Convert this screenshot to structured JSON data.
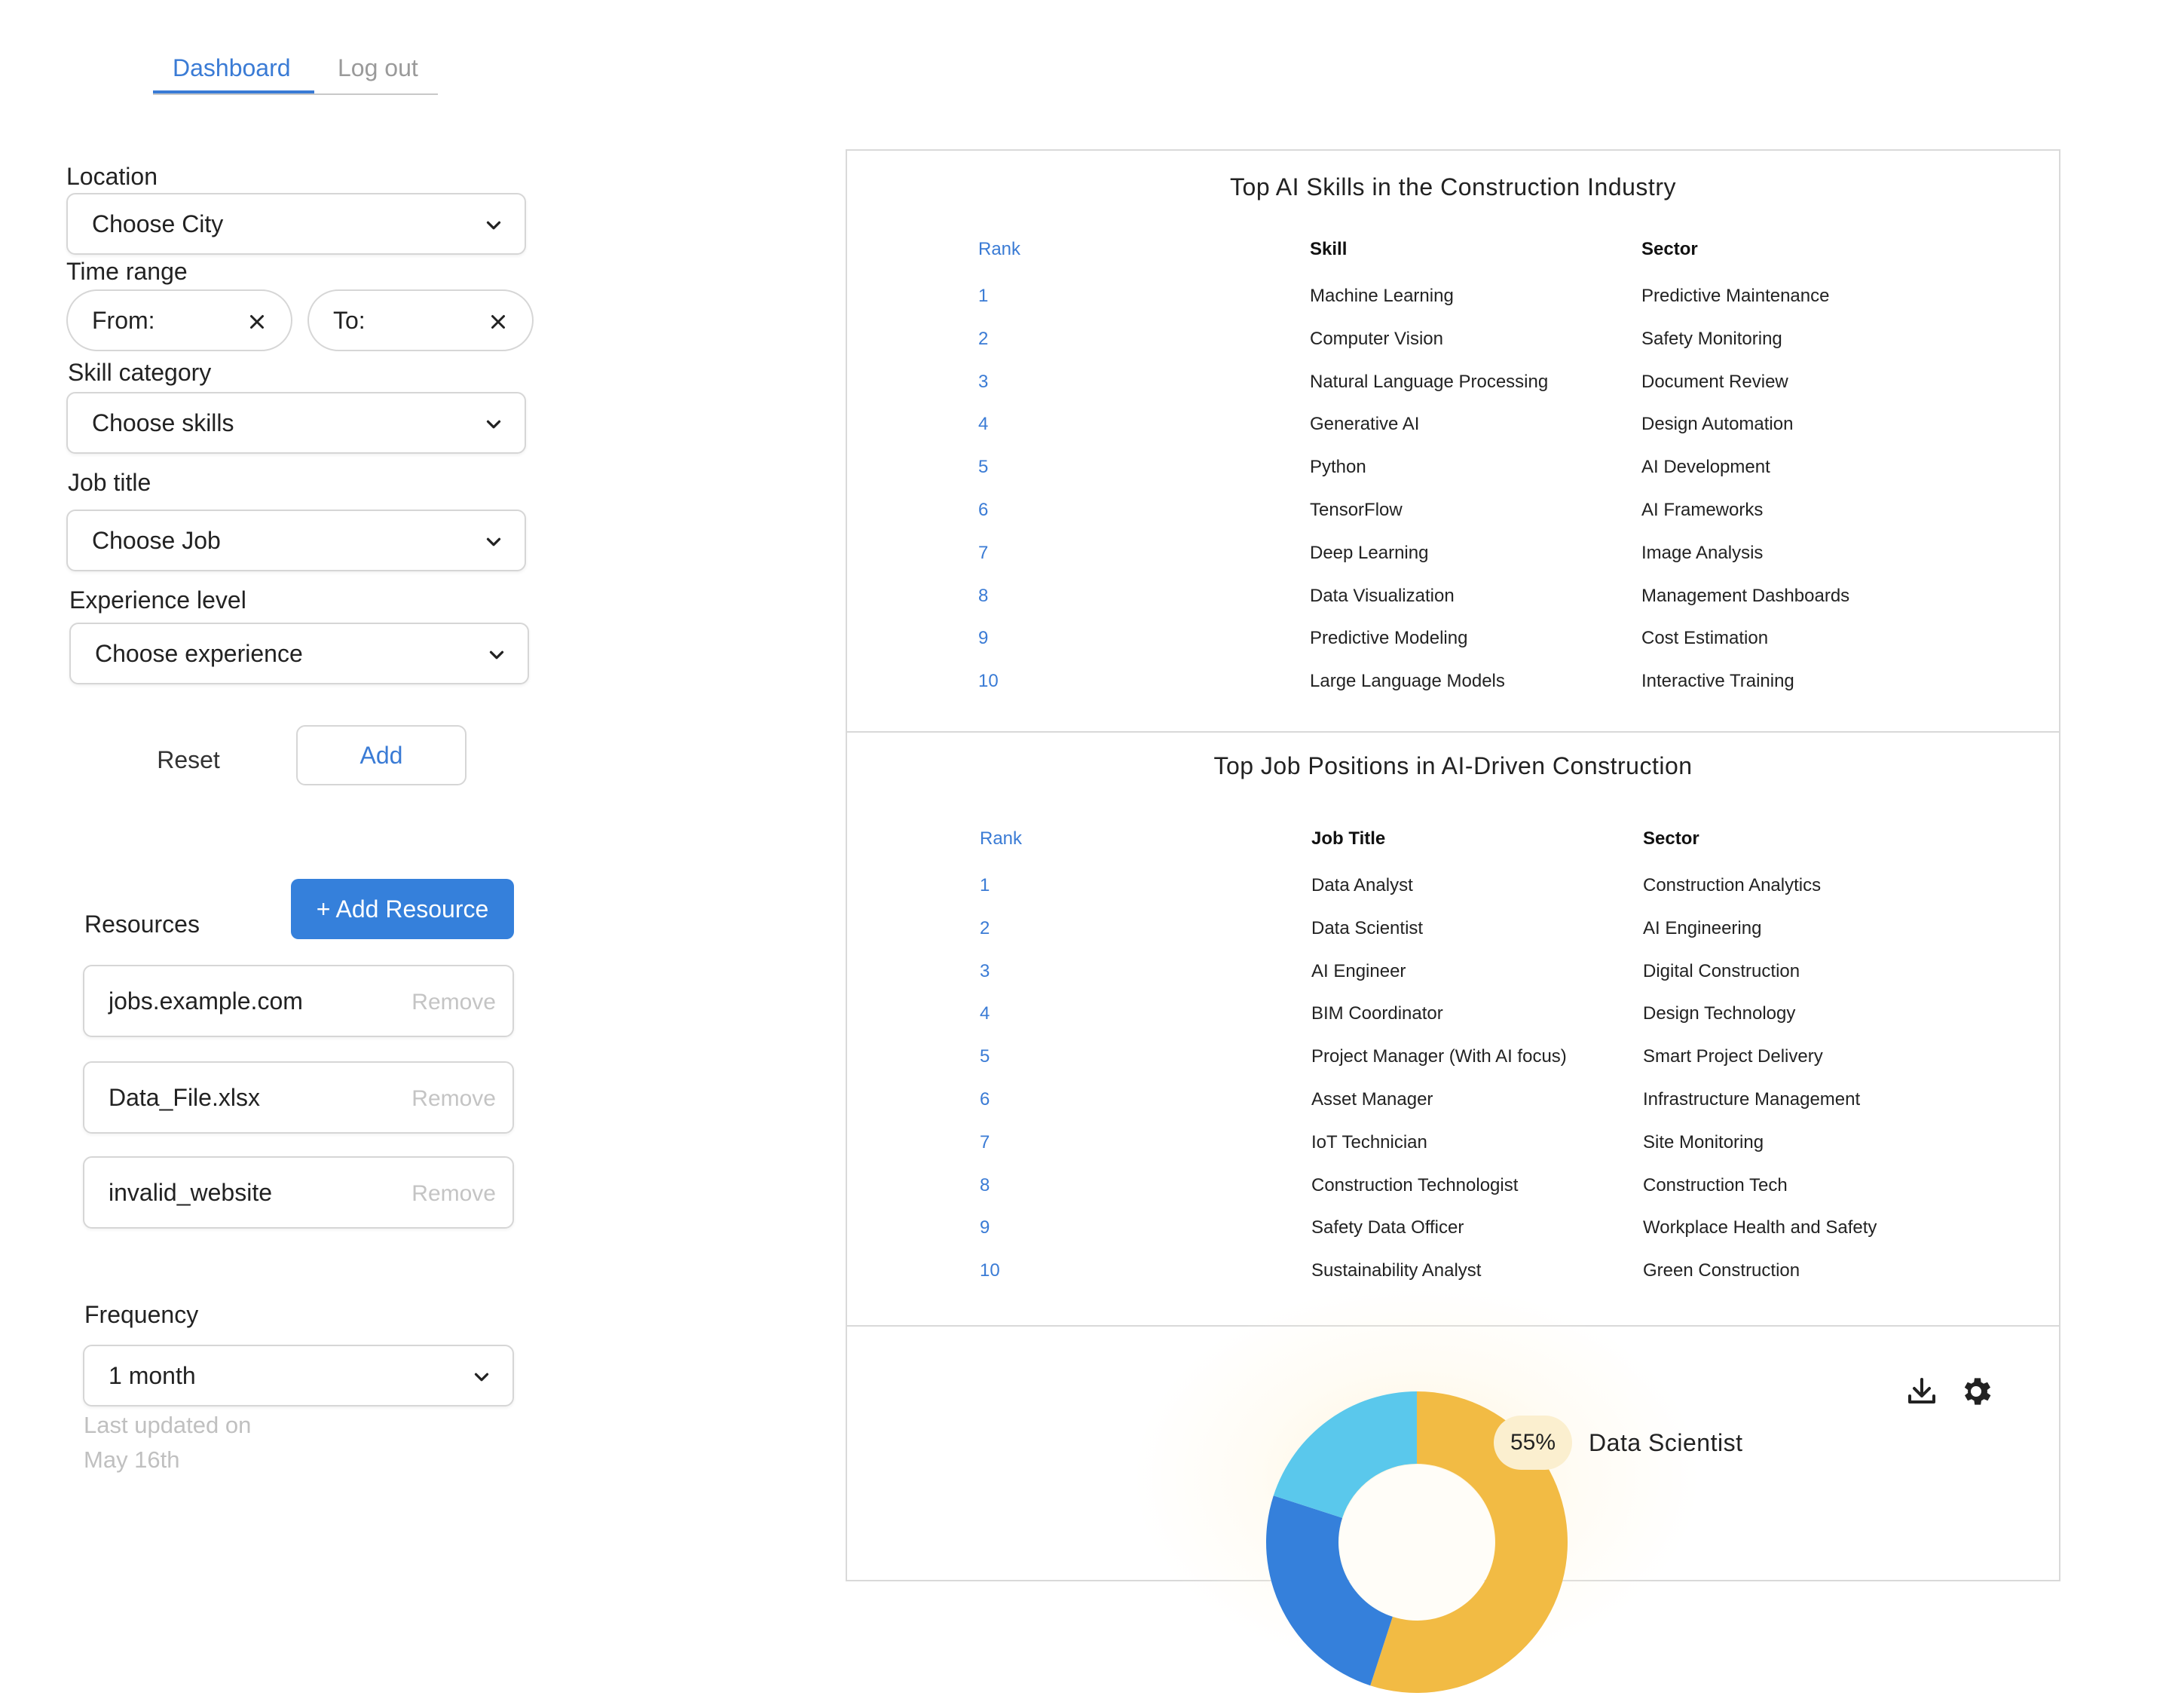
{
  "nav": {
    "tabs": [
      {
        "label": "Dashboard"
      },
      {
        "label": "Log out"
      }
    ]
  },
  "filters": {
    "location": {
      "label": "Location",
      "value": "Choose City"
    },
    "time_range": {
      "label": "Time range",
      "from": "From:",
      "to": "To:"
    },
    "skill_category": {
      "label": "Skill category",
      "value": "Choose skills"
    },
    "job_title": {
      "label": "Job title",
      "value": "Choose Job"
    },
    "experience": {
      "label": "Experience level",
      "value": "Choose experience"
    },
    "reset_label": "Reset",
    "add_label": "Add"
  },
  "resources": {
    "label": "Resources",
    "add_label": "+ Add Resource",
    "remove_label": "Remove",
    "items": [
      "jobs.example.com",
      "Data_File.xlsx",
      "invalid_website"
    ]
  },
  "frequency": {
    "label": "Frequency",
    "value": "1 month",
    "last_updated_line1": "Last updated on",
    "last_updated_line2": "May 16th"
  },
  "skills_table": {
    "title": "Top AI Skills in the Construction Industry",
    "headers": [
      "Rank",
      "Skill",
      "Sector"
    ],
    "rows": [
      [
        "1",
        "Machine Learning",
        "Predictive Maintenance"
      ],
      [
        "2",
        "Computer Vision",
        "Safety Monitoring"
      ],
      [
        "3",
        "Natural Language Processing",
        "Document Review"
      ],
      [
        "4",
        "Generative AI",
        "Design Automation"
      ],
      [
        "5",
        "Python",
        "AI Development"
      ],
      [
        "6",
        "TensorFlow",
        "AI Frameworks"
      ],
      [
        "7",
        "Deep Learning",
        "Image Analysis"
      ],
      [
        "8",
        "Data Visualization",
        "Management Dashboards"
      ],
      [
        "9",
        "Predictive Modeling",
        "Cost Estimation"
      ],
      [
        "10",
        "Large Language Models",
        "Interactive Training"
      ]
    ]
  },
  "jobs_table": {
    "title": "Top Job Positions in AI-Driven Construction",
    "headers": [
      "Rank",
      "Job Title",
      "Sector"
    ],
    "rows": [
      [
        "1",
        "Data Analyst",
        "Construction Analytics"
      ],
      [
        "2",
        "Data Scientist",
        "AI Engineering"
      ],
      [
        "3",
        "AI Engineer",
        "Digital Construction"
      ],
      [
        "4",
        "BIM Coordinator",
        "Design Technology"
      ],
      [
        "5",
        "Project Manager (With AI focus)",
        "Smart Project Delivery"
      ],
      [
        "6",
        "Asset Manager",
        "Infrastructure Management"
      ],
      [
        "7",
        "IoT Technician",
        "Site Monitoring"
      ],
      [
        "8",
        "Construction Technologist",
        "Construction Tech"
      ],
      [
        "9",
        "Safety Data Officer",
        "Workplace Health and Safety"
      ],
      [
        "10",
        "Sustainability Analyst",
        "Green Construction"
      ]
    ]
  },
  "chart_data": {
    "type": "pie",
    "highlight_label": "55%",
    "highlight_name": "Data Scientist",
    "slices": [
      {
        "name": "Data Scientist",
        "value": 55,
        "color": "#f2bb44"
      },
      {
        "name": "",
        "value": 25,
        "color": "#3580db"
      },
      {
        "name": "",
        "value": 20,
        "color": "#5ac8ec"
      }
    ]
  },
  "colors": {
    "accent": "#3a7bd5",
    "primary_button": "#3580db"
  },
  "icons": {
    "download": "download-icon",
    "settings": "gear-icon"
  }
}
